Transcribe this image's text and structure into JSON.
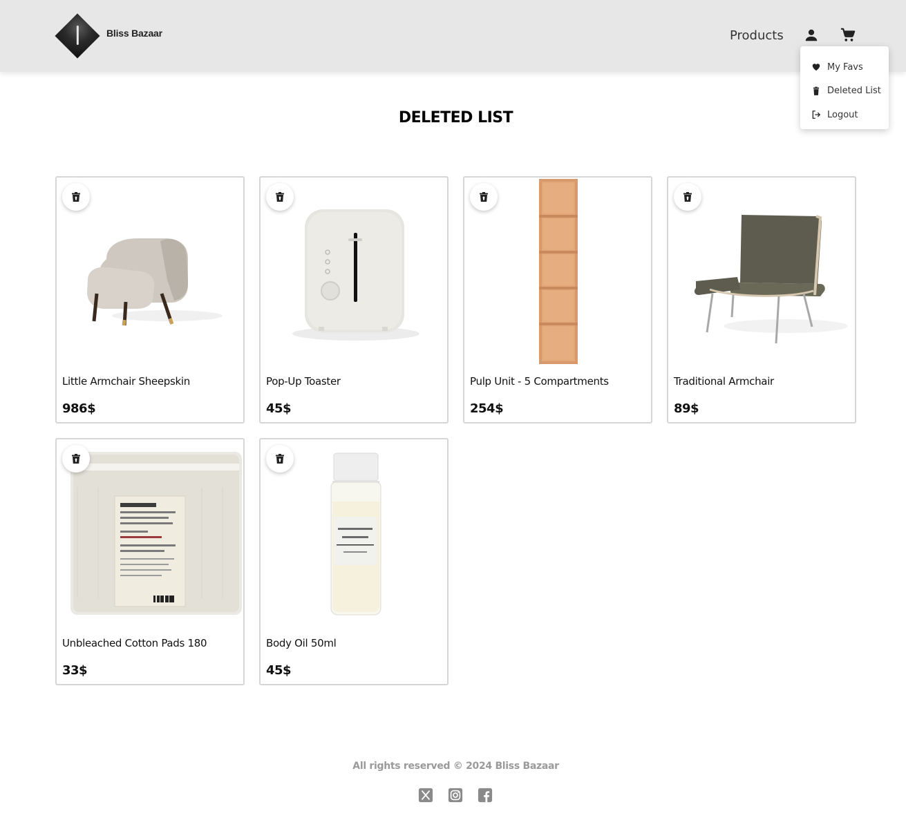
{
  "header": {
    "brand": "Bliss Bazaar",
    "nav_products": "Products",
    "user_icon": "person-icon",
    "cart_icon": "shopping-cart-icon"
  },
  "dropdown": {
    "items": [
      {
        "label": "My Favs",
        "icon": "heart-icon"
      },
      {
        "label": "Deleted List",
        "icon": "trash-icon"
      },
      {
        "label": "Logout",
        "icon": "logout-icon"
      }
    ]
  },
  "page_title": "DELETED LIST",
  "products": [
    {
      "name": "Little Armchair Sheepskin",
      "price": "986$"
    },
    {
      "name": "Pop-Up Toaster",
      "price": "45$"
    },
    {
      "name": "Pulp Unit - 5 Compartments",
      "price": "254$"
    },
    {
      "name": "Traditional Armchair",
      "price": "89$"
    },
    {
      "name": "Unbleached Cotton Pads 180",
      "price": "33$"
    },
    {
      "name": "Body Oil 50ml",
      "price": "45$"
    }
  ],
  "footer": {
    "copyright": "All rights reserved © 2024 Bliss Bazaar",
    "socials": [
      "x-icon",
      "instagram-icon",
      "facebook-icon"
    ]
  },
  "colors": {
    "header_bg": "#e7e7e7",
    "card_border": "#d6d6d6",
    "footer_text": "#9a9a9a"
  }
}
